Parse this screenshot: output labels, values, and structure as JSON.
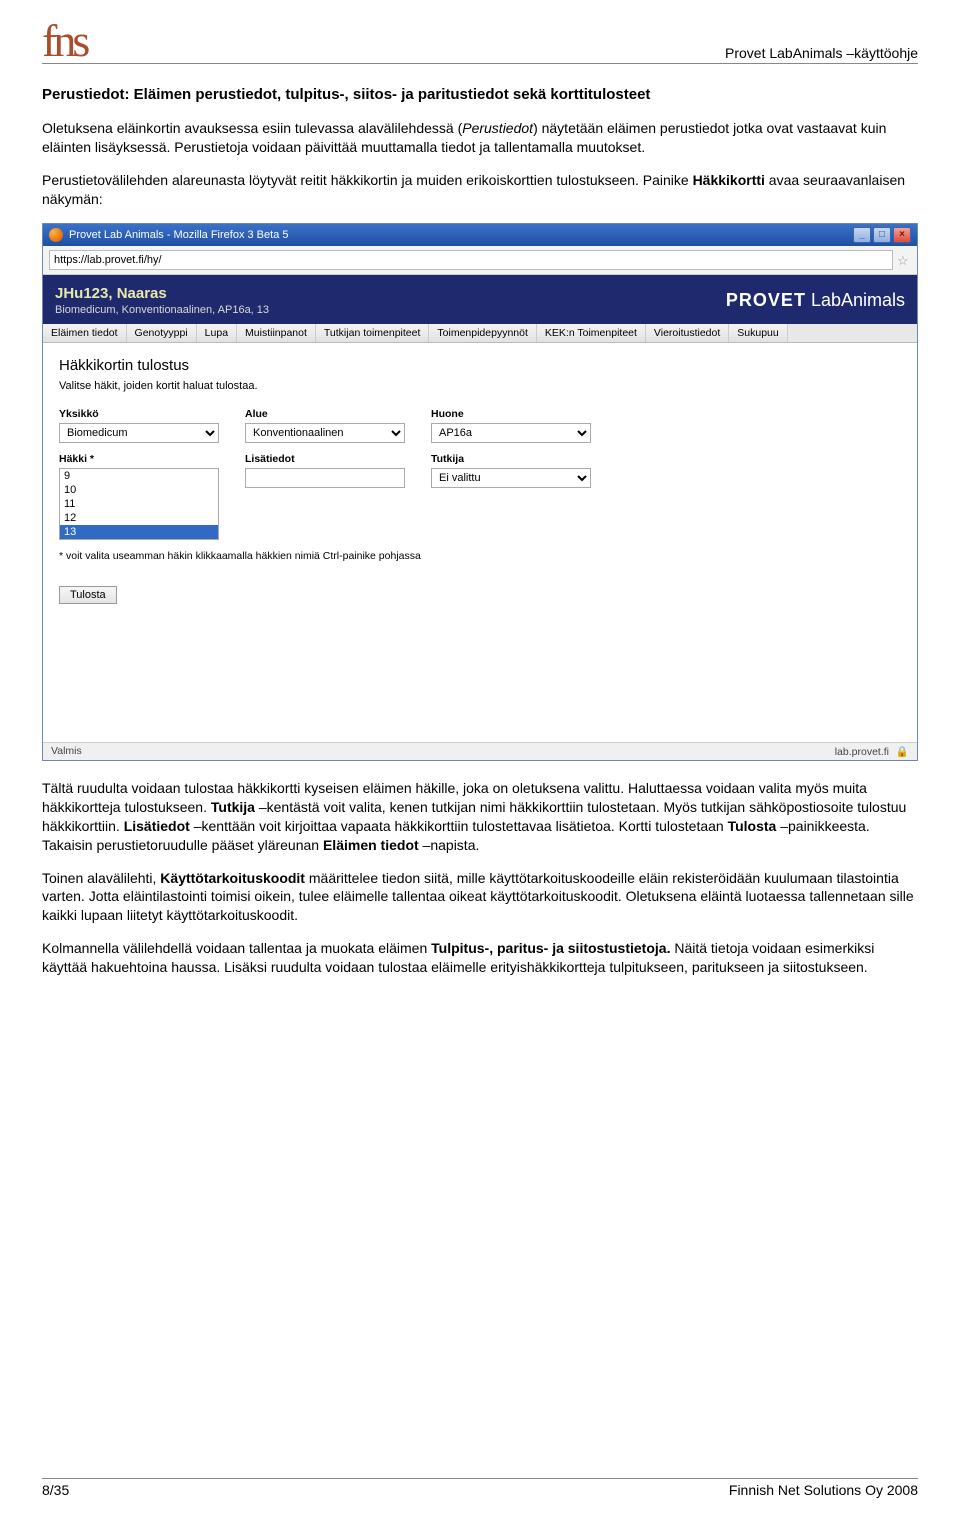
{
  "header": {
    "logo": "fns",
    "doc_title": "Provet LabAnimals –käyttöohje"
  },
  "section": {
    "title": "Perustiedot: Eläimen perustiedot, tulpitus-, siitos- ja paritustiedot sekä korttitulosteet",
    "p1_a": "Oletuksena eläinkortin avauksessa esiin tulevassa alavälilehdessä (",
    "p1_italic": "Perustiedot",
    "p1_b": ") näytetään eläimen perustiedot jotka ovat vastaavat kuin eläinten lisäyksessä. Perustietoja voidaan päivittää muuttamalla tiedot ja tallentamalla muutokset.",
    "p2_a": "Perustietovälilehden alareunasta löytyvät reitit häkkikortin ja muiden erikoiskorttien tulostukseen. Painike ",
    "p2_bold": "Häkkikortti",
    "p2_b": " avaa seuraavanlaisen näkymän:"
  },
  "browser": {
    "title": "Provet Lab Animals - Mozilla Firefox 3 Beta 5",
    "url": "https://lab.provet.fi/hy/",
    "status_left": "Valmis",
    "status_right": "lab.provet.fi"
  },
  "app": {
    "animal_name": "JHu123, Naaras",
    "animal_sub": "Biomedicum, Konventionaalinen, AP16a, 13",
    "brand_bold": "PROVET",
    "brand_light": " LabAnimals",
    "tabs": [
      "Eläimen tiedot",
      "Genotyyppi",
      "Lupa",
      "Muistiinpanot",
      "Tutkijan toimenpiteet",
      "Toimenpidepyynnöt",
      "KEK:n Toimenpiteet",
      "Vieroitustiedot",
      "Sukupuu"
    ],
    "page_title": "Häkkikortin tulostus",
    "page_sub": "Valitse häkit, joiden kortit haluat tulostaa.",
    "form": {
      "yksikko_label": "Yksikkö",
      "yksikko_value": "Biomedicum",
      "alue_label": "Alue",
      "alue_value": "Konventionaalinen",
      "huone_label": "Huone",
      "huone_value": "AP16a",
      "hakki_label": "Häkki *",
      "hakki_options": [
        "9",
        "10",
        "11",
        "12",
        "13"
      ],
      "hakki_selected": "13",
      "lisatiedot_label": "Lisätiedot",
      "lisatiedot_value": "",
      "tutkija_label": "Tutkija",
      "tutkija_value": "Ei valittu",
      "footnote": "* voit valita useamman häkin klikkaamalla häkkien nimiä Ctrl-painike pohjassa",
      "print_btn": "Tulosta"
    }
  },
  "after": {
    "p1_a": "Tältä ruudulta voidaan tulostaa häkkikortti kyseisen eläimen häkille, joka on oletuksena valittu. Haluttaessa voidaan valita myös muita häkkikortteja tulostukseen. ",
    "p1_b1": "Tutkija",
    "p1_c": " –kentästä voit valita, kenen tutkijan nimi häkkikorttiin tulostetaan. Myös tutkijan sähköpostiosoite tulostuu häkkikorttiin. ",
    "p1_b2": "Lisätiedot",
    "p1_d": " –kenttään voit kirjoittaa vapaata häkkikorttiin tulostettavaa lisätietoa. Kortti tulostetaan ",
    "p1_b3": "Tulosta",
    "p1_e": " –painikkeesta. Takaisin perustietoruudulle pääset yläreunan ",
    "p1_b4": "Eläimen tiedot",
    "p1_f": " –napista.",
    "p2_a": "Toinen alavälilehti, ",
    "p2_b1": "Käyttötarkoituskoodit",
    "p2_b": " määrittelee tiedon siitä, mille käyttötarkoituskoodeille eläin rekisteröidään kuulumaan tilastointia varten. Jotta eläintilastointi toimisi oikein, tulee eläimelle tallentaa oikeat käyttötarkoituskoodit. Oletuksena eläintä luotaessa tallennetaan sille kaikki lupaan liitetyt käyttötarkoituskoodit.",
    "p3_a": "Kolmannella välilehdellä voidaan tallentaa ja muokata eläimen ",
    "p3_b1": "Tulpitus-, paritus- ja siitostustietoja.",
    "p3_b": " Näitä tietoja voidaan esimerkiksi käyttää hakuehtoina haussa. Lisäksi ruudulta voidaan tulostaa eläimelle erityishäkkikortteja tulpitukseen, paritukseen ja siitostukseen."
  },
  "footer": {
    "page": "8/35",
    "company": "Finnish Net Solutions Oy 2008"
  }
}
